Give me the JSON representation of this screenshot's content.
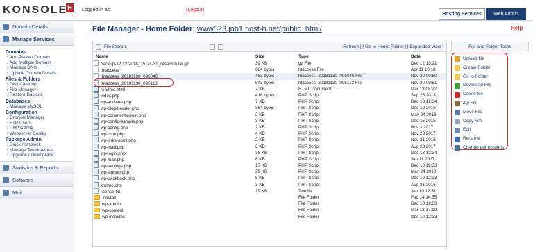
{
  "header": {
    "logo": "KONSOLE",
    "logo_badge": "H",
    "logged_in": "Logged in as:",
    "logout": "(Logout)",
    "tabs": [
      "Hosting Services",
      "Web Admin"
    ]
  },
  "sidebar": {
    "domain_details": "Domain Details",
    "manage_services": "Manage Services",
    "sections": [
      {
        "title": "Domains",
        "links": [
          "Add Parked Domain",
          "Add Multiple Domain",
          "Manage DNS",
          "Update Domain Details"
        ]
      },
      {
        "title": "Files & Folders",
        "links": [
          "Disk Cleanup",
          "File Manager",
          "Restore Backup"
        ]
      },
      {
        "title": "Databases",
        "links": [
          "Manage MySQL"
        ]
      },
      {
        "title": "Configuration",
        "links": [
          "Cronjob Manager",
          "FTP Users",
          "PHP Config",
          "Webserver Config"
        ]
      },
      {
        "title": "Package Admin",
        "links": [
          "Block / Unblock",
          "Manage Terminations",
          "Upgrade / Downgrade"
        ]
      }
    ],
    "bottom": [
      "Statistics & Reports",
      "Software",
      "Mail"
    ]
  },
  "main": {
    "title_prefix": "File Manager - Home Folder: ",
    "title_path": "www523.jnb1.host-h.net/public_html/",
    "help": "Help"
  },
  "filebar": {
    "search_label": "FileSearch:",
    "links": "[ Refresh ] [ Go to Home Folder ] [ Expanded View ]"
  },
  "columns": [
    "Name",
    "Size",
    "Type",
    "Date"
  ],
  "files": [
    {
      "name": "backup-12.12.2018_15-21-31_reselxqb.tar.gz",
      "size": "39 KB",
      "type": "gz File",
      "date": "Dec 12 15:21",
      "kind": "file"
    },
    {
      "name": ".htaccess",
      "size": "684 bytes",
      "type": "htaccess File",
      "date": "Apr 11 10:18",
      "kind": "file"
    },
    {
      "name": ".htaccess_20181130_095046",
      "size": "453 bytes",
      "type": "htaccess_20181130_095046 File",
      "date": "Nov 30 09:50",
      "kind": "file"
    },
    {
      "name": ".htaccess_20181130_095113",
      "size": "543 bytes",
      "type": "htaccess_20181130_095113 File",
      "date": "Nov 30 09:51",
      "kind": "file"
    },
    {
      "name": "readme.html",
      "size": "7 KB",
      "type": "HTML Document",
      "date": "Mar 13 08:22",
      "kind": "htm"
    },
    {
      "name": "index.php",
      "size": "418 bytes",
      "type": "PHP Script",
      "date": "Sep 25 2013",
      "kind": "php"
    },
    {
      "name": "wp-activate.php",
      "size": "7 KB",
      "type": "PHP Script",
      "date": "Dec 13 12:34",
      "kind": "php"
    },
    {
      "name": "wp-blog-header.php",
      "size": "364 bytes",
      "type": "PHP Script",
      "date": "Dec 19 2015",
      "kind": "php"
    },
    {
      "name": "wp-comments-post.php",
      "size": "2 KB",
      "type": "PHP Script",
      "date": "May 24 2018",
      "kind": "php"
    },
    {
      "name": "wp-config-sample.php",
      "size": "3 KB",
      "type": "PHP Script",
      "date": "Dec 16 2015",
      "kind": "php"
    },
    {
      "name": "wp-config.php",
      "size": "2 KB",
      "type": "PHP Script",
      "date": "Nov 3 2017",
      "kind": "php"
    },
    {
      "name": "wp-cron.php",
      "size": "4 KB",
      "type": "PHP Script",
      "date": "Nov 23 2017",
      "kind": "php"
    },
    {
      "name": "wp-links-opml.php",
      "size": "2 KB",
      "type": "PHP Script",
      "date": "Nov 21 2016",
      "kind": "php"
    },
    {
      "name": "wp-load.php",
      "size": "3 KB",
      "type": "PHP Script",
      "date": "Aug 23 2017",
      "kind": "php"
    },
    {
      "name": "wp-login.php",
      "size": "36 KB",
      "type": "PHP Script",
      "date": "Dec 13 12:34",
      "kind": "php"
    },
    {
      "name": "wp-mail.php",
      "size": "8 KB",
      "type": "PHP Script",
      "date": "Jan 11 2017",
      "kind": "php"
    },
    {
      "name": "wp-settings.php",
      "size": "17 KB",
      "type": "PHP Script",
      "date": "Dec 10 12:33",
      "kind": "php"
    },
    {
      "name": "wp-signup.php",
      "size": "29 KB",
      "type": "PHP Script",
      "date": "May 24 2018",
      "kind": "php"
    },
    {
      "name": "wp-trackback.php",
      "size": "5 KB",
      "type": "PHP Script",
      "date": "Dec 10 12:33",
      "kind": "php"
    },
    {
      "name": "xmlrpc.php",
      "size": "3 KB",
      "type": "PHP Script",
      "date": "Aug 31 2016",
      "kind": "php"
    },
    {
      "name": "license.txt",
      "size": "19 KB",
      "type": "Textfile",
      "date": "Jan 10 12:51",
      "kind": "file"
    },
    {
      "name": ".cm4all",
      "size": "",
      "type": "File Folder",
      "date": "Feb 14 14:55",
      "kind": "dir"
    },
    {
      "name": "wp-admin",
      "size": "",
      "type": "File Folder",
      "date": "Dec 10 12:33",
      "kind": "dir"
    },
    {
      "name": "wp-content",
      "size": "",
      "type": "File Folder",
      "date": "Mar 13 17:19",
      "kind": "dir"
    },
    {
      "name": "wp-includes",
      "size": "",
      "type": "File Folder",
      "date": "Dec 10 12:33",
      "kind": "dir"
    }
  ],
  "tasks": {
    "header": "File and Folder Tasks",
    "items": [
      {
        "label": "Upload file",
        "color": "#e0a020"
      },
      {
        "label": "Create Folder",
        "color": "#f2c94c"
      },
      {
        "label": "Go to Folder",
        "color": "#f2c94c"
      },
      {
        "label": "Download File",
        "color": "#3a9a3a"
      },
      {
        "label": "Delete file",
        "color": "#d02828"
      },
      {
        "label": "Zip File",
        "color": "#8a6d3b"
      },
      {
        "label": "Move File",
        "color": "#5a7ca8"
      },
      {
        "label": "Copy File",
        "color": "#9aa8bb"
      },
      {
        "label": "Edit",
        "color": "#6b86ad"
      },
      {
        "label": "Rename",
        "color": "#3d6fb0"
      },
      {
        "label": "Change permissions",
        "color": "#4f6f9a"
      }
    ]
  }
}
